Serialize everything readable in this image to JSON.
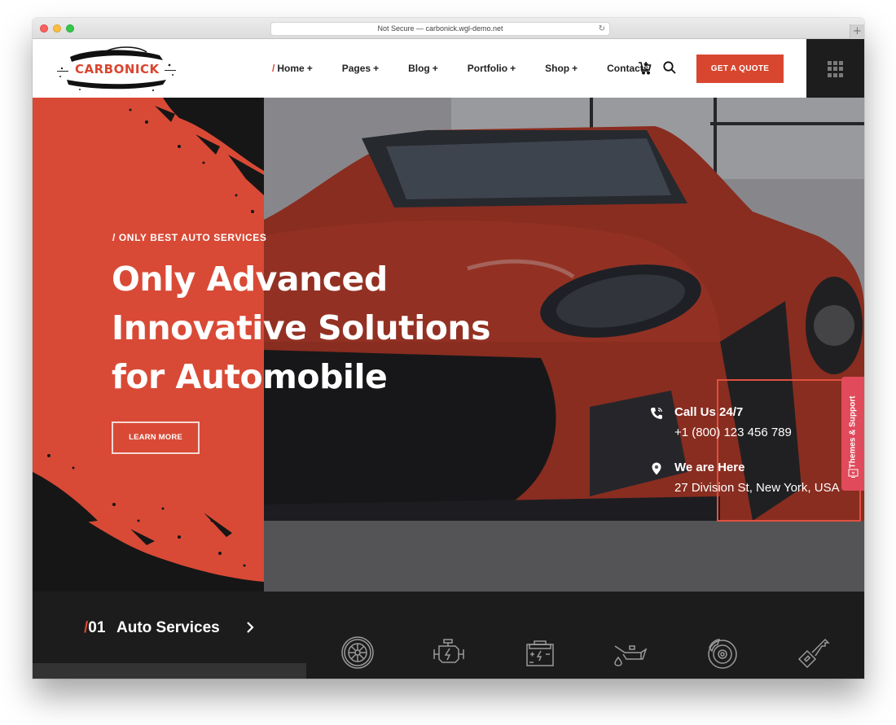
{
  "browser": {
    "url_text": "Not Secure — carbonick.wgl-demo.net",
    "reload_icon": "reload-icon",
    "new_tab_icon": "plus-icon",
    "new_tab_glyph": "+"
  },
  "header": {
    "logo_text": "CARBONICK",
    "nav": [
      {
        "label": "Home",
        "active": true,
        "prefix": "/",
        "suffix": "+"
      },
      {
        "label": "Pages",
        "suffix": "+"
      },
      {
        "label": "Blog",
        "suffix": "+"
      },
      {
        "label": "Portfolio",
        "suffix": "+"
      },
      {
        "label": "Shop",
        "suffix": "+"
      },
      {
        "label": "Contacts",
        "suffix": ""
      }
    ],
    "cart_icon": "cart-icon",
    "search_icon": "search-icon",
    "quote_button": "GET A QUOTE",
    "menu_icon": "grid-menu-icon"
  },
  "hero": {
    "subtitle": "/ ONLY BEST AUTO SERVICES",
    "headline_lines": [
      "Only Advanced",
      "Innovative Solutions",
      "for Automobile"
    ],
    "learn_more": "LEARN MORE",
    "contacts": [
      {
        "icon": "phone-icon",
        "title": "Call Us 24/7",
        "value": "+1 (800) 123 456 789"
      },
      {
        "icon": "location-pin-icon",
        "title": "We are Here",
        "value": "27 Division St, New York, USA"
      }
    ],
    "support_tab": "Themes & Support"
  },
  "services": {
    "slash": "/",
    "number": "01",
    "title": "Auto Services",
    "icons": [
      "wheel-icon",
      "engine-icon",
      "battery-icon",
      "oil-can-icon",
      "brake-disc-icon",
      "car-key-icon"
    ]
  },
  "colors": {
    "accent": "#d9462f",
    "dark": "#1c1c1c",
    "support": "#e04a5a"
  }
}
